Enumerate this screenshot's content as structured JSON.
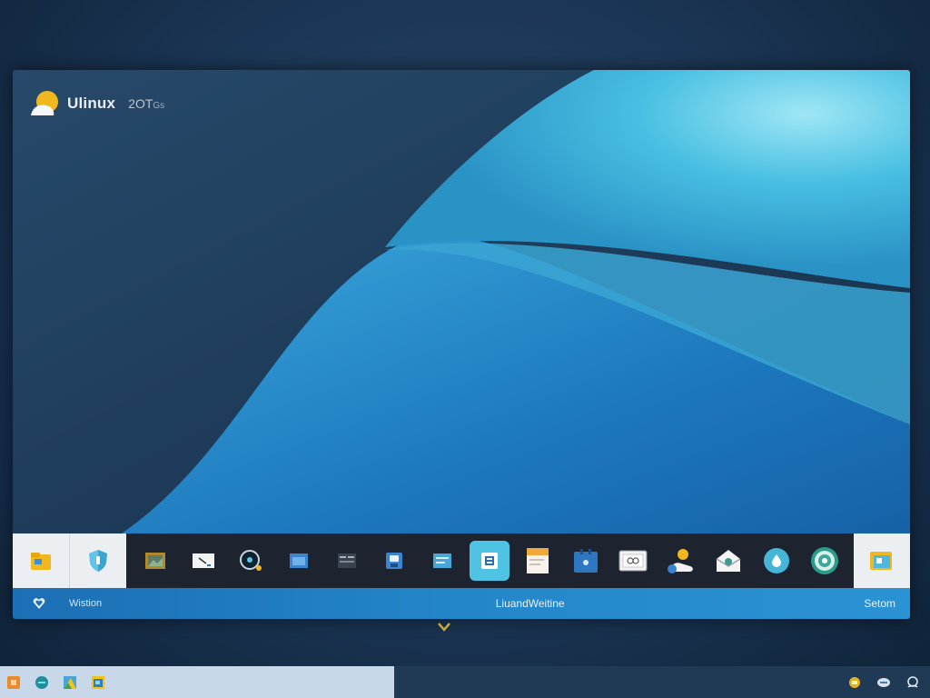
{
  "brand": {
    "name": "Ulinux",
    "version": "2OT",
    "version_suffix": "Gs",
    "logo_icon": "sun-logo-icon"
  },
  "colors": {
    "accent": "#4ec3e4",
    "brand_logo": "#f0b81e",
    "status_bar": "#2386c8",
    "dock_background": "#1d2430",
    "taskbar_tray": "#c9d8e8"
  },
  "dock": {
    "left_pinned": [
      {
        "icon": "folder-icon"
      },
      {
        "icon": "shield-icon"
      }
    ],
    "apps": [
      {
        "icon": "image-viewer-icon",
        "active": false
      },
      {
        "icon": "notepad-icon",
        "active": false
      },
      {
        "icon": "camera-icon",
        "active": false
      },
      {
        "icon": "window-icon",
        "active": false
      },
      {
        "icon": "terminal-icon",
        "active": false
      },
      {
        "icon": "save-icon",
        "active": false
      },
      {
        "icon": "settings-panel-icon",
        "active": false
      },
      {
        "icon": "app-store-icon",
        "active": true
      },
      {
        "icon": "document-icon",
        "active": false
      },
      {
        "icon": "calendar-icon",
        "active": false
      },
      {
        "icon": "media-player-icon",
        "active": false
      },
      {
        "icon": "toggle-icon",
        "active": false
      },
      {
        "icon": "mail-icon",
        "active": false
      },
      {
        "icon": "drop-icon",
        "active": false
      },
      {
        "icon": "globe-icon",
        "active": false
      }
    ],
    "right_pinned": {
      "icon": "files-icon"
    }
  },
  "statusbar": {
    "left_label": "Wistion",
    "center_label": "LiuandWeitine",
    "right_label": "Setom"
  },
  "taskbar": {
    "left_icons": [
      "orange-app-icon",
      "teal-app-icon",
      "image-app-icon",
      "photo-app-icon"
    ],
    "tray_icons": [
      "notification-icon",
      "network-icon",
      "support-icon"
    ]
  }
}
